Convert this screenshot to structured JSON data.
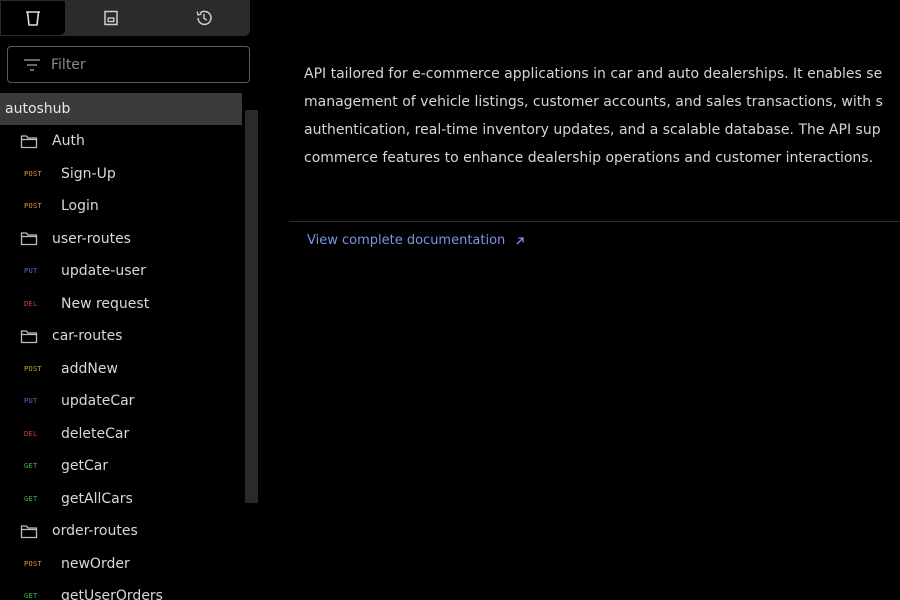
{
  "sidebar": {
    "tabs": [
      {
        "icon": "collections-icon"
      },
      {
        "icon": "environment-icon"
      },
      {
        "icon": "history-icon"
      }
    ],
    "filter": {
      "placeholder": "Filter",
      "value": ""
    },
    "collection": {
      "name": "autoshub"
    },
    "tree": [
      {
        "type": "folder",
        "label": "Auth"
      },
      {
        "type": "request",
        "method": "POST",
        "label": "Sign-Up"
      },
      {
        "type": "request",
        "method": "POST",
        "label": "Login"
      },
      {
        "type": "folder",
        "label": "user-routes"
      },
      {
        "type": "request",
        "method": "PUT",
        "label": "update-user"
      },
      {
        "type": "request",
        "method": "DEL",
        "label": "New request"
      },
      {
        "type": "folder",
        "label": "car-routes"
      },
      {
        "type": "request",
        "method": "POST",
        "label": "addNew"
      },
      {
        "type": "request",
        "method": "PUT",
        "label": "updateCar"
      },
      {
        "type": "request",
        "method": "DEL",
        "label": "deleteCar"
      },
      {
        "type": "request",
        "method": "GET",
        "label": "getCar"
      },
      {
        "type": "request",
        "method": "GET",
        "label": "getAllCars"
      },
      {
        "type": "folder",
        "label": "order-routes"
      },
      {
        "type": "request",
        "method": "POST",
        "label": "newOrder"
      },
      {
        "type": "request",
        "method": "GET",
        "label": "getUserOrders"
      }
    ]
  },
  "main": {
    "description": [
      "API tailored for e-commerce applications in car and auto dealerships. It enables se",
      "management of vehicle listings, customer accounts, and sales transactions, with s",
      "authentication, real-time inventory updates, and a scalable database. The API sup",
      "commerce features to enhance dealership operations and customer interactions."
    ],
    "doc_link": "View complete documentation"
  },
  "colors": {
    "background": "#000000",
    "POST": "#d9a035",
    "PUT": "#4a6fc9",
    "DEL": "#d23c3c",
    "GET": "#3fb54e",
    "link": "#7b93e8"
  }
}
